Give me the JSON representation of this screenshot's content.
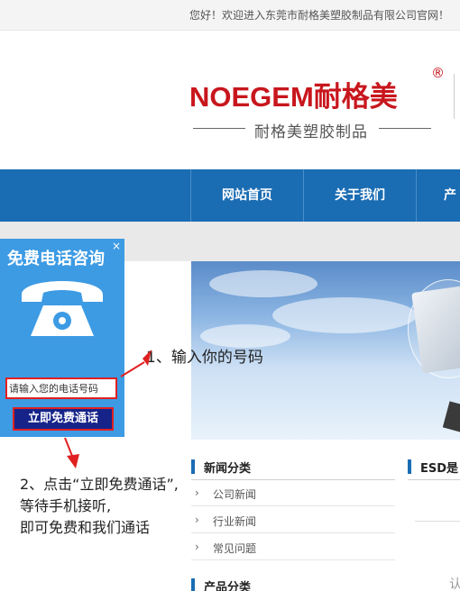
{
  "topbar": {
    "welcome": "您好！欢迎进入东莞市耐格美塑胶制品有限公司官网！"
  },
  "logo": {
    "brand": "NOEGEM耐格美",
    "reg_mark": "®",
    "subtitle": "耐格美塑胶制品"
  },
  "nav": {
    "items": [
      "网站首页",
      "关于我们",
      "产"
    ]
  },
  "sections": {
    "news": {
      "title": "新闻分类",
      "items": [
        "公司新闻",
        "行业新闻",
        "常见问题"
      ]
    },
    "esd": {
      "title": "ESD是"
    },
    "products": {
      "title": "产品分类"
    },
    "right_glyph": "认"
  },
  "callbox": {
    "title": "免费电话咨询",
    "close": "×",
    "input_placeholder": "请输入您的电话号码",
    "button_label": "立即免费通话"
  },
  "annotations": {
    "step1": "1、输入你的号码",
    "step2_line1": "2、点击“立即免费通话”,",
    "step2_line2": "等待手机接听,",
    "step2_line3": "即可免费和我们通话"
  },
  "colors": {
    "nav_blue": "#1a6cb3",
    "brand_red": "#c8161d",
    "callbox_blue": "#3d9be4",
    "highlight_red": "#e02020",
    "button_navy": "#16248a"
  },
  "icons": {
    "phone": "telephone-icon",
    "arrow": "chevron-right-icon",
    "close": "close-icon"
  }
}
